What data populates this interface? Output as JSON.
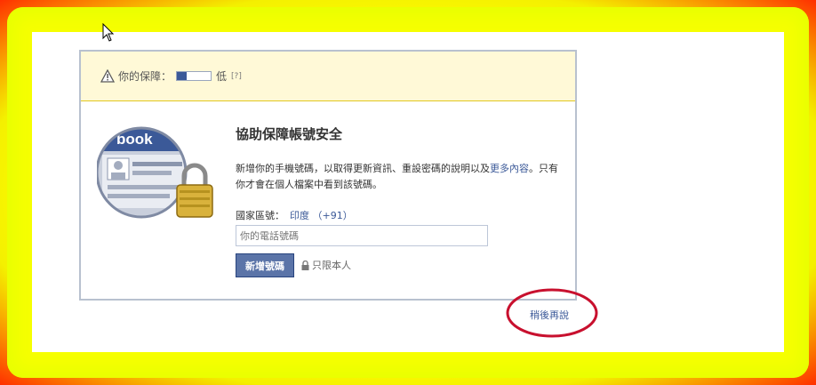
{
  "warning": {
    "label": "你的保障：",
    "level_text": "低",
    "help": "[?]",
    "strength_fraction": 0.3
  },
  "illustration": {
    "logo_text": "book"
  },
  "dialog": {
    "title": "協助保障帳號安全",
    "desc_text": "新增你的手機號碼，以取得更新資訊、重設密碼的說明以及",
    "desc_link": "更多內容",
    "desc_tail": "。只有你才會在個人檔案中看到該號碼。",
    "country_label": "國家區號：",
    "country_value": "印度 （+91）",
    "phone_placeholder": "你的電話號碼",
    "add_button": "新增號碼",
    "privacy_text": "只限本人"
  },
  "later_link": "稍後再說",
  "colors": {
    "brand": "#3b5998",
    "warning_bg": "#fff9d7",
    "annotation": "#c8102e"
  }
}
